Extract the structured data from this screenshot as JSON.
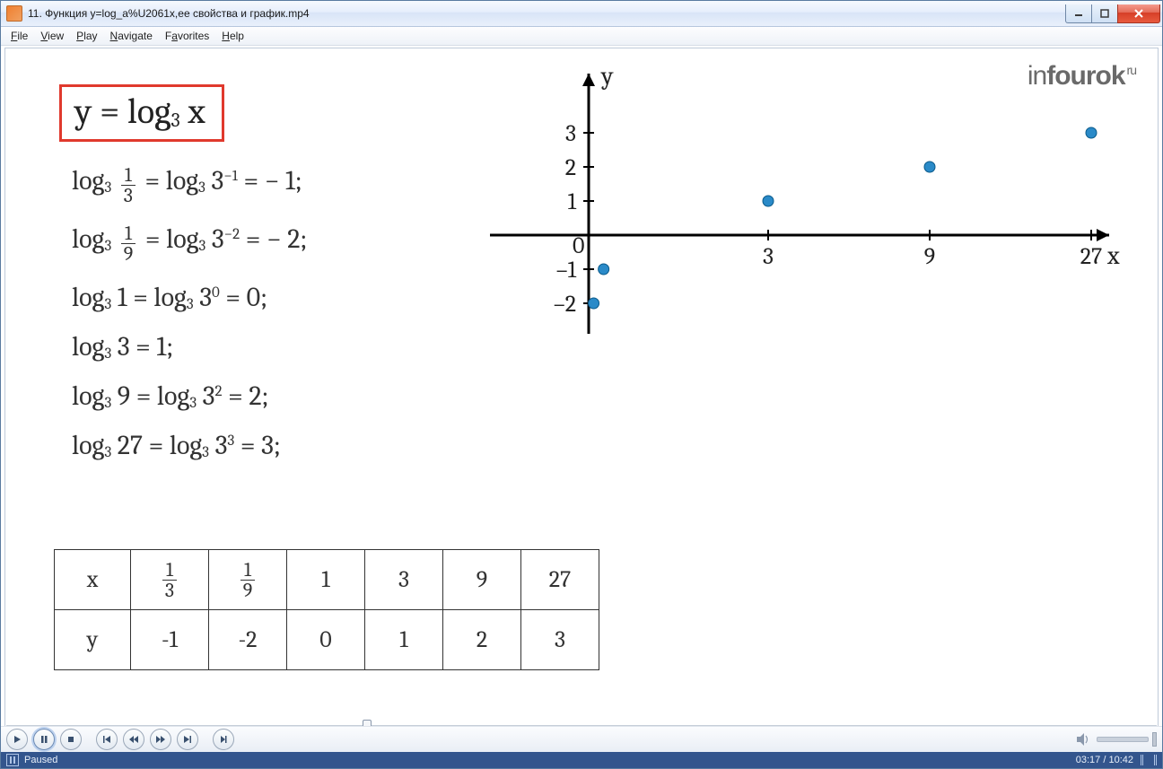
{
  "window": {
    "title": "11. Функция y=log_a%U2061x,ее свойства и график.mp4"
  },
  "menu": {
    "file": "File",
    "view": "View",
    "play": "Play",
    "navigate": "Navigate",
    "favorites": "Favorites",
    "help": "Help"
  },
  "slide": {
    "logo": "infourok",
    "logo_tld": "ru",
    "main_eq": "y = log₃ x",
    "lines": [
      "log₃ 1/3 = log₃ 3⁻¹ = − 1;",
      "log₃ 1/9 = log₃ 3⁻² = − 2;",
      "log₃ 1 = log₃ 3⁰ = 0;",
      "log₃ 3 = 1;",
      "log₃ 9 = log₃ 3² = 2;",
      "log₃ 27 = log₃ 3³ = 3;"
    ],
    "table": {
      "row1_head": "x",
      "row1": [
        "1/3",
        "1/9",
        "1",
        "3",
        "9",
        "27"
      ],
      "row2_head": "y",
      "row2": [
        "-1",
        "-2",
        "0",
        "1",
        "2",
        "3"
      ]
    }
  },
  "chart_data": {
    "type": "scatter",
    "title": "",
    "xlabel": "x",
    "ylabel": "y",
    "x_ticks": [
      3,
      9,
      27
    ],
    "y_ticks": [
      -2,
      -1,
      1,
      2,
      3
    ],
    "origin_label": "0",
    "points": [
      {
        "x": 0.111,
        "y": -2,
        "label": "1/9"
      },
      {
        "x": 0.333,
        "y": -1,
        "label": "1/3"
      },
      {
        "x": 3,
        "y": 1,
        "label": "3"
      },
      {
        "x": 9,
        "y": 2,
        "label": "9"
      },
      {
        "x": 27,
        "y": 3,
        "label": "27"
      }
    ],
    "xlim": [
      0,
      28
    ],
    "ylim": [
      -2.5,
      3.5
    ]
  },
  "player": {
    "progress_pct": 31,
    "status": "Paused",
    "time": "03:17 / 10:42"
  }
}
